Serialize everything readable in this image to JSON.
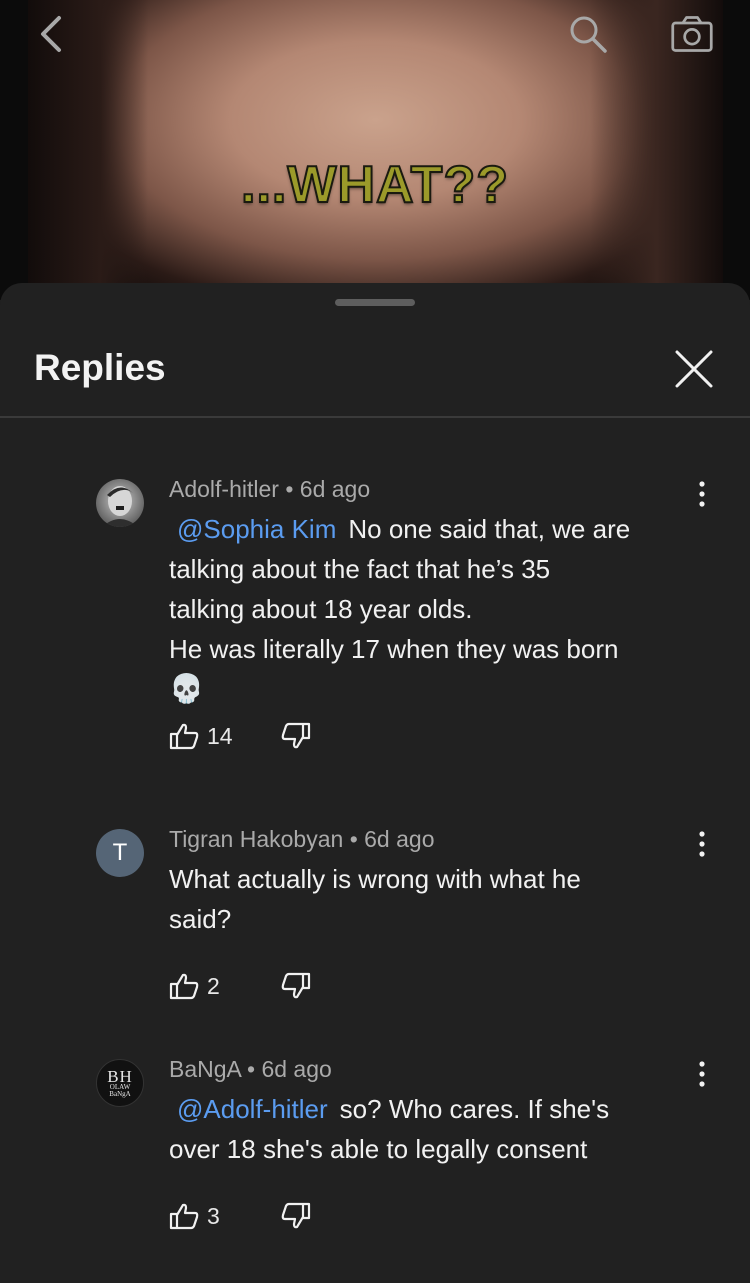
{
  "video": {
    "caption": "...WHAT??"
  },
  "icons": {
    "back": "chevron-left-icon",
    "search": "search-icon",
    "camera": "camera-icon",
    "close": "close-icon",
    "more": "more-vertical-icon",
    "like": "thumbs-up-icon",
    "dislike": "thumbs-down-icon"
  },
  "sheet": {
    "title": "Replies"
  },
  "colors": {
    "background": "#212121",
    "mention": "#5b9cf0",
    "meta": "#aaaaaa"
  },
  "comments": [
    {
      "author": "Adolf-hitler",
      "time": "6d ago",
      "mention": "@Sophia Kim",
      "text_line1": "No one said that, we are",
      "text_line2": "talking about the fact that he’s 35",
      "text_line3": "talking about 18 year olds.",
      "text_line4": "He was literally 17 when they was born",
      "emoji": "💀",
      "likes": "14"
    },
    {
      "author": "Tigran Hakobyan",
      "avatar_letter": "T",
      "time": "6d ago",
      "text_line1": "What actually is wrong with what he",
      "text_line2": "said?",
      "likes": "2"
    },
    {
      "author": "BaNgA",
      "avatar_text_big": "BH",
      "avatar_text_small1": "OLAW",
      "avatar_text_small2": "BaNgA",
      "time": "6d ago",
      "mention": "@Adolf-hitler",
      "text_line1": "so? Who cares. If she's",
      "text_line2": "over 18 she's able to legally consent",
      "likes": "3"
    }
  ]
}
